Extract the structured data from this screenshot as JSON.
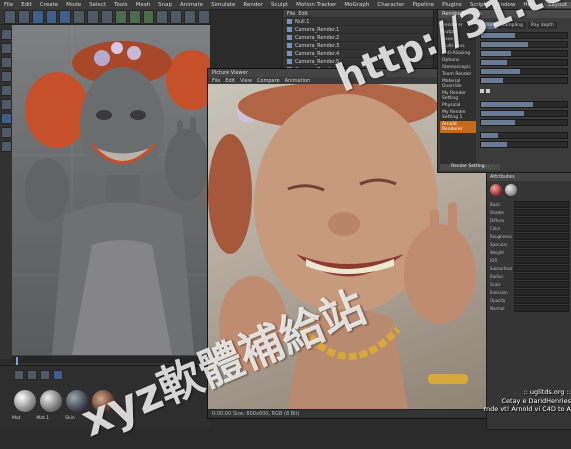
{
  "menubar": {
    "items": [
      "File",
      "Edit",
      "Create",
      "Mode",
      "Select",
      "Tools",
      "Mesh",
      "Snap",
      "Animate",
      "Simulate",
      "Render",
      "Sculpt",
      "Motion Tracker",
      "MoGraph",
      "Character",
      "Pipeline",
      "Plugins",
      "Script",
      "Window",
      "Help"
    ],
    "layout_label": "Layout"
  },
  "picture_viewer": {
    "title": "Picture Viewer",
    "menu": [
      "File",
      "Edit",
      "View",
      "Compare",
      "Animation"
    ],
    "status": "0:00:00   Size: 800x600, RGB (8 Bit)"
  },
  "render_settings": {
    "title": "Render Settings",
    "left_items": [
      "Renderer",
      "Output",
      "Save",
      "Multi-Pass",
      "Anti-Aliasing",
      "Options",
      "Stereoscopic",
      "Team Render",
      "Material Override",
      "My Render Setting",
      "Physical",
      "My Render Setting 1",
      "Arnold Renderer"
    ],
    "tabs": [
      "Main",
      "Sampling",
      "Ray depth"
    ],
    "button_label": "Render Setting..."
  },
  "object_manager": {
    "items": [
      "Null.1",
      "Camera_Render.1",
      "Camera_Render.2",
      "Camera_Render.3",
      "Camera_Render.4",
      "Camera_Render.5",
      "Camera_Render.6"
    ]
  },
  "attribute_panel": {
    "title": "Attributes",
    "rows": [
      "Basic",
      "Shader",
      "Diffuse",
      "Color",
      "Roughness",
      "Specular",
      "Weight",
      "IOR",
      "Subsurface",
      "Radius",
      "Scale",
      "Emission",
      "Opacity",
      "Normal"
    ]
  },
  "materials": {
    "names": [
      "Mat",
      "Mat.1",
      "Skin",
      "Hair",
      "Head"
    ]
  },
  "watermark": {
    "url": "http://31.to",
    "chinese": "xyz軟體補給站"
  },
  "credits": {
    "line1": ":: uglitds.org ::",
    "line2": "Cetay e DaridHenries",
    "line3": "rnde vt! Arnold vi C4D to A"
  },
  "colors": {
    "accent": "#c46a1c",
    "hair": "#c5502a",
    "skin_grey": "#6a6c6e",
    "gold": "#d8a93a"
  }
}
